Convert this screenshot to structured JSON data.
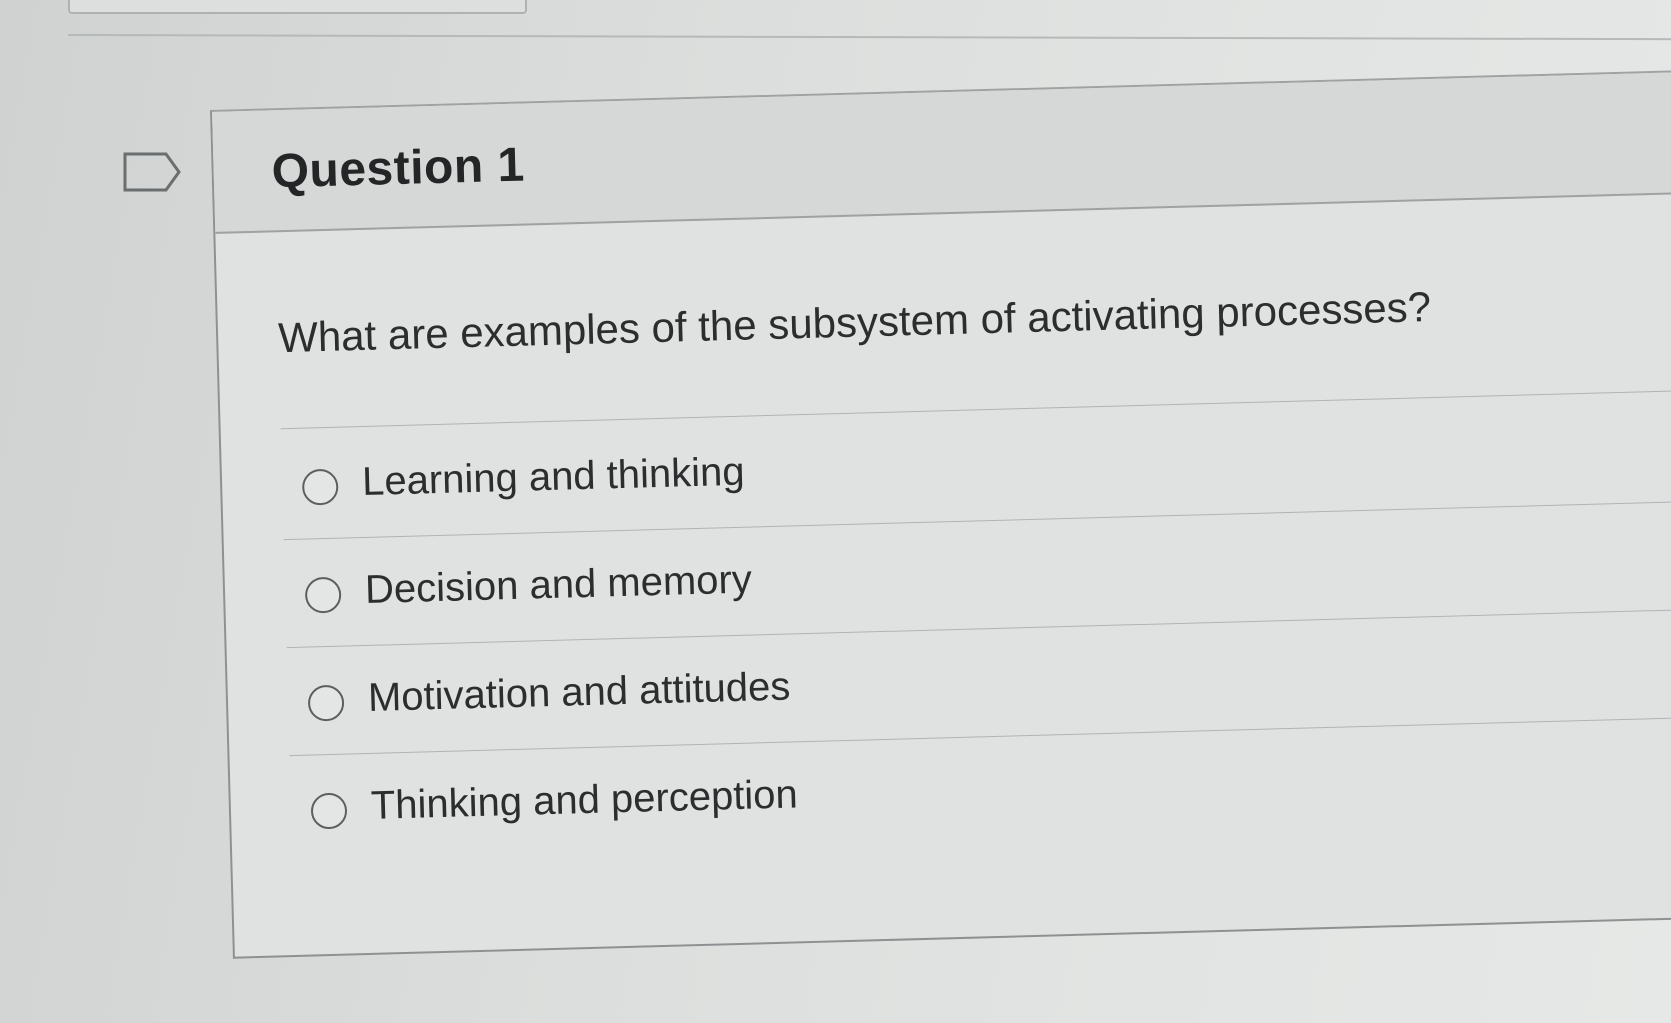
{
  "question": {
    "title": "Question 1",
    "text": "What are examples of the subsystem of activating processes?",
    "options": [
      {
        "label": "Learning and thinking"
      },
      {
        "label": "Decision and memory"
      },
      {
        "label": "Motivation and attitudes"
      },
      {
        "label": "Thinking and perception"
      }
    ]
  },
  "icons": {
    "flag": "flag-outline-icon",
    "radio": "radio-unchecked-icon"
  },
  "colors": {
    "background": "#d7d9d8",
    "card_header": "#d5d8d7",
    "card_body": "#e0e2e1",
    "text": "#2b2d2e",
    "border": "#8d9192"
  }
}
